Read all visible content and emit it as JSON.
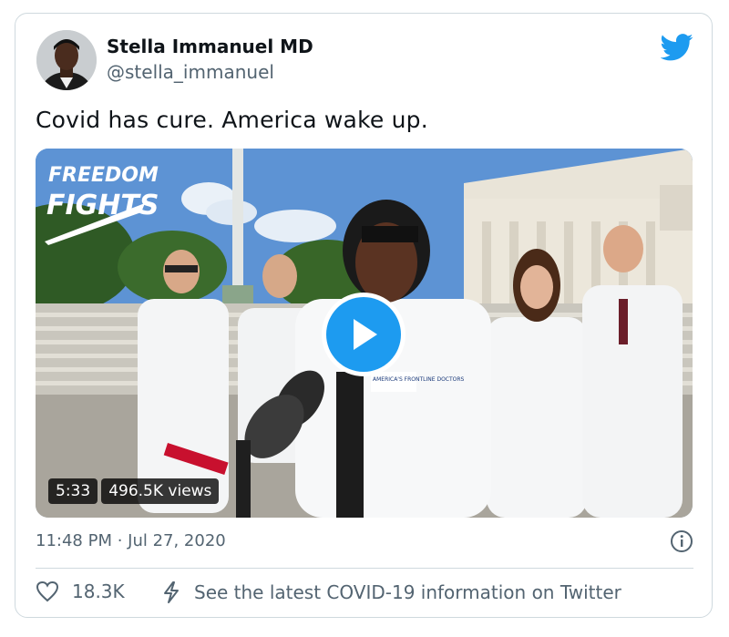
{
  "tweet": {
    "author_name": "Stella Immanuel MD",
    "author_handle": "@stella_immanuel",
    "text": "Covid has cure. America wake up.",
    "timestamp": "11:48 PM · Jul 27, 2020",
    "likes": "18.3K",
    "covid_link": "See the latest COVID-19 information on Twitter"
  },
  "video": {
    "duration": "5:33",
    "views": "496.5K views",
    "overlay_logo_line1": "FREEDOM",
    "overlay_logo_line2": "FIGHTS",
    "coat_logo_text": "AMERICA'S FRONTLINE DOCTORS"
  },
  "icons": {
    "brand": "twitter-bird-icon",
    "play": "play-icon",
    "info": "info-icon",
    "like": "heart-icon",
    "covid": "lightning-icon"
  },
  "colors": {
    "twitter_blue": "#1d9bf0",
    "text_primary": "#0f1419",
    "text_secondary": "#536471",
    "border": "#cfd9de"
  }
}
